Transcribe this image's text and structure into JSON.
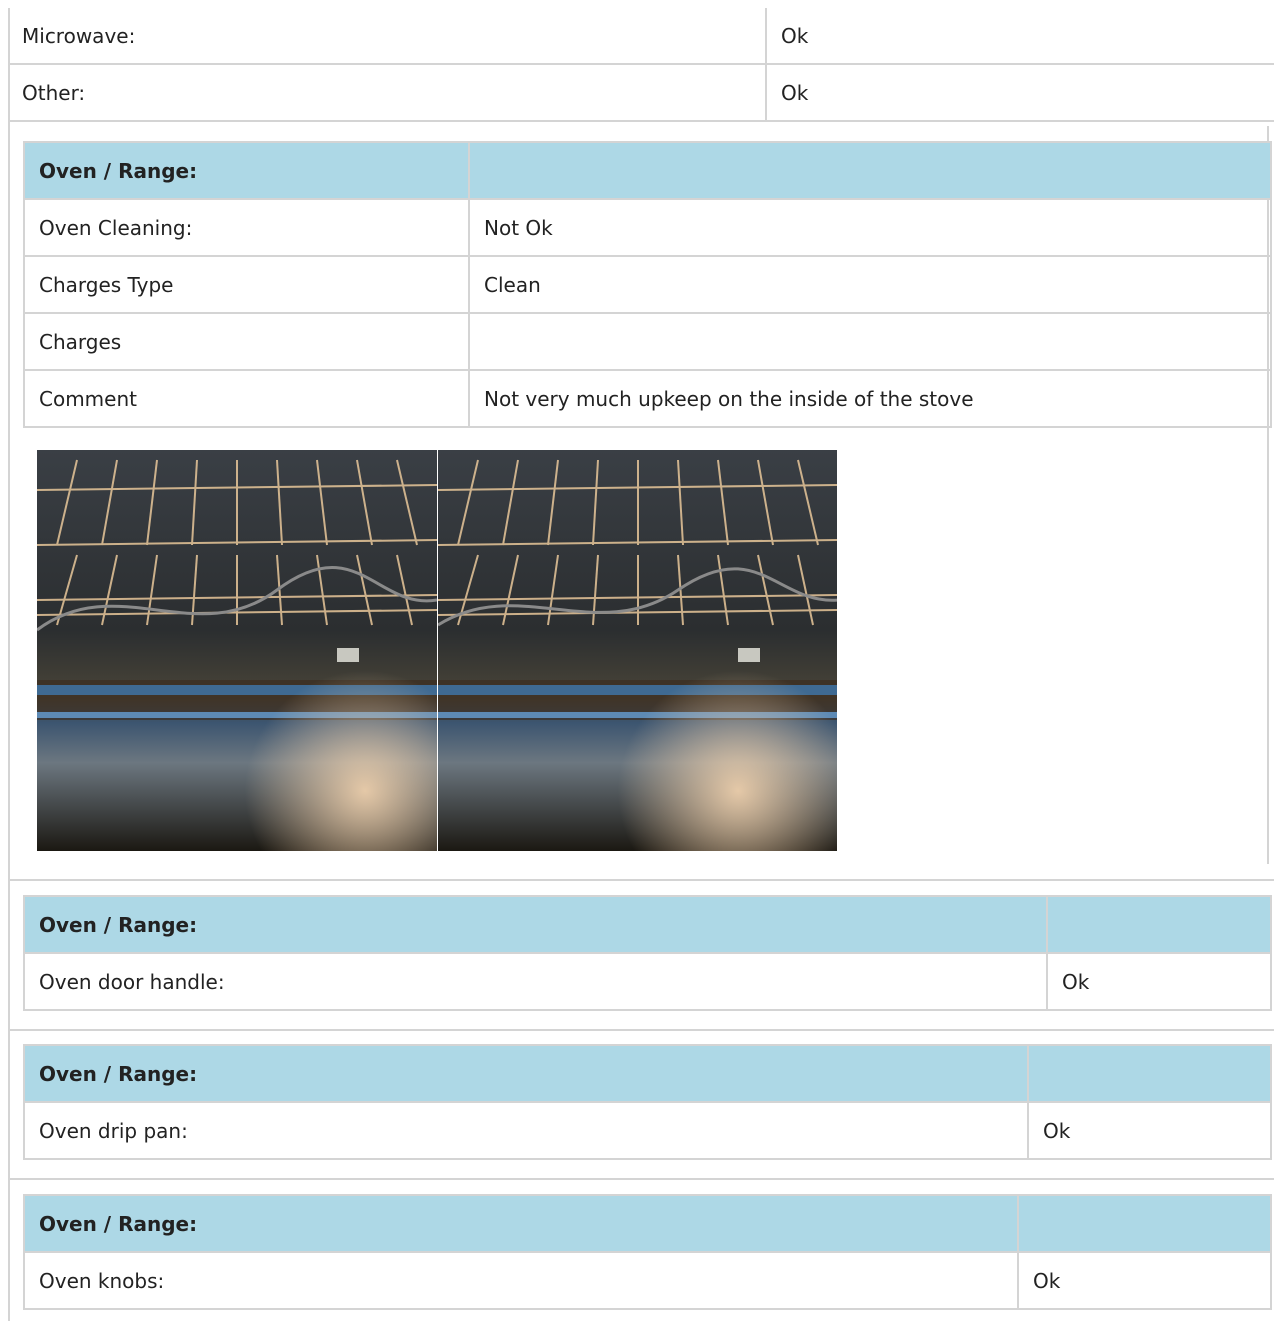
{
  "top_rows": [
    {
      "label": "Microwave:",
      "value": "Ok"
    },
    {
      "label": "Other:",
      "value": "Ok"
    }
  ],
  "section_1": {
    "header": "Oven / Range:",
    "rows": [
      {
        "label": "Oven Cleaning:",
        "value": "Not Ok"
      },
      {
        "label": "Charges Type",
        "value": "Clean"
      },
      {
        "label": "Charges",
        "value": ""
      },
      {
        "label": "Comment",
        "value": "Not very much upkeep on the inside of the stove"
      }
    ],
    "photos": [
      "oven-interior-photo",
      "oven-interior-photo"
    ]
  },
  "section_2": {
    "header": "Oven / Range:",
    "rows": [
      {
        "label": "Oven door handle:",
        "value": "Ok"
      }
    ]
  },
  "section_3": {
    "header": "Oven / Range:",
    "rows": [
      {
        "label": "Oven drip pan:",
        "value": "Ok"
      }
    ]
  },
  "section_4": {
    "header": "Oven / Range:",
    "rows": [
      {
        "label": "Oven knobs:",
        "value": "Ok"
      }
    ]
  },
  "colors": {
    "header_bg": "#add8e6",
    "border": "#d4d4d4",
    "text": "#222222"
  }
}
